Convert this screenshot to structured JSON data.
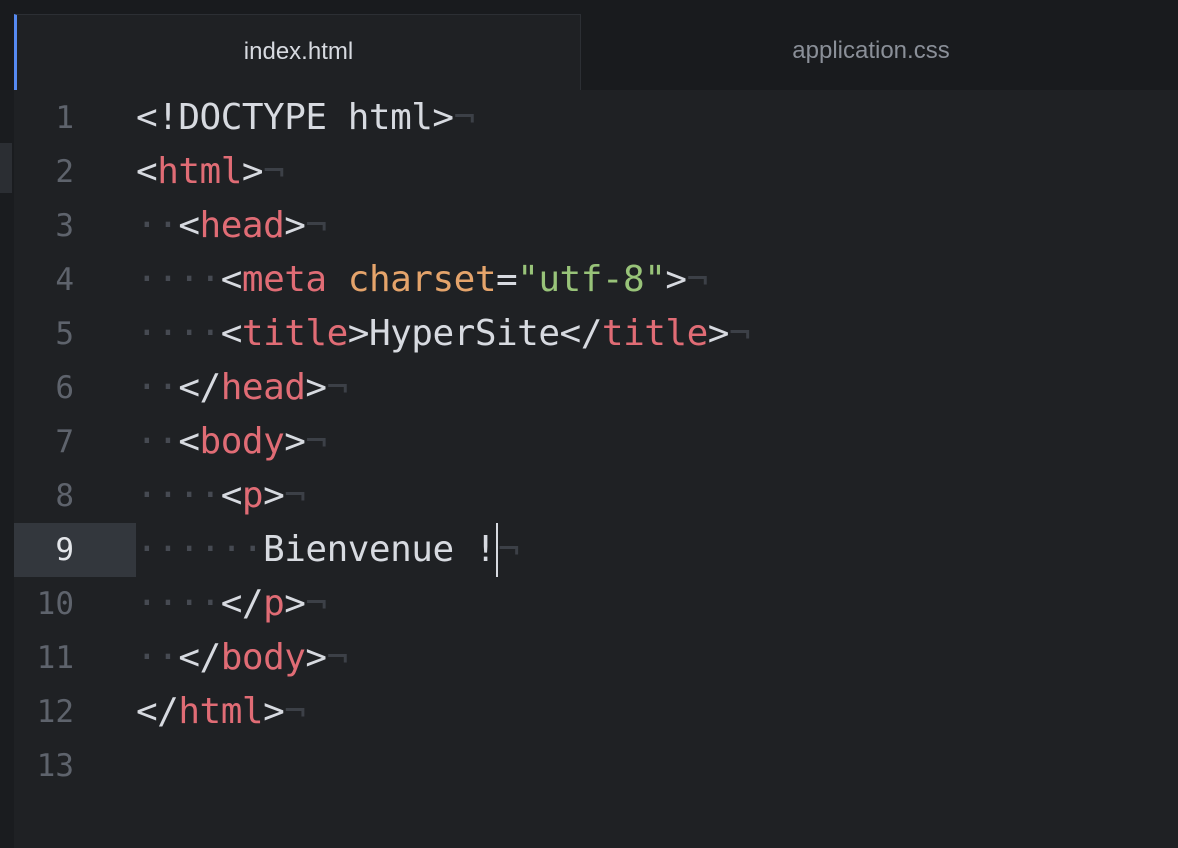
{
  "tabs": [
    {
      "label": "index.html",
      "active": true
    },
    {
      "label": "application.css",
      "active": false
    }
  ],
  "editor": {
    "current_line": 9,
    "lines": [
      {
        "num": "1",
        "tokens": [
          {
            "t": "<!DOCTYPE html>",
            "c": "p"
          },
          {
            "t": "¬",
            "c": "eol"
          }
        ]
      },
      {
        "num": "2",
        "tokens": [
          {
            "t": "<",
            "c": "p"
          },
          {
            "t": "html",
            "c": "tag"
          },
          {
            "t": ">",
            "c": "p"
          },
          {
            "t": "¬",
            "c": "eol"
          }
        ]
      },
      {
        "num": "3",
        "tokens": [
          {
            "t": "··",
            "c": "ind"
          },
          {
            "t": "<",
            "c": "p"
          },
          {
            "t": "head",
            "c": "tag"
          },
          {
            "t": ">",
            "c": "p"
          },
          {
            "t": "¬",
            "c": "eol"
          }
        ]
      },
      {
        "num": "4",
        "tokens": [
          {
            "t": "····",
            "c": "ind"
          },
          {
            "t": "<",
            "c": "p"
          },
          {
            "t": "meta",
            "c": "tag"
          },
          {
            "t": " ",
            "c": "p"
          },
          {
            "t": "charset",
            "c": "attr"
          },
          {
            "t": "=",
            "c": "p"
          },
          {
            "t": "\"utf-8\"",
            "c": "str"
          },
          {
            "t": ">",
            "c": "p"
          },
          {
            "t": "¬",
            "c": "eol"
          }
        ]
      },
      {
        "num": "5",
        "tokens": [
          {
            "t": "····",
            "c": "ind"
          },
          {
            "t": "<",
            "c": "p"
          },
          {
            "t": "title",
            "c": "tag"
          },
          {
            "t": ">",
            "c": "p"
          },
          {
            "t": "HyperSite",
            "c": "txt"
          },
          {
            "t": "</",
            "c": "p"
          },
          {
            "t": "title",
            "c": "tag"
          },
          {
            "t": ">",
            "c": "p"
          },
          {
            "t": "¬",
            "c": "eol"
          }
        ]
      },
      {
        "num": "6",
        "tokens": [
          {
            "t": "··",
            "c": "ind"
          },
          {
            "t": "</",
            "c": "p"
          },
          {
            "t": "head",
            "c": "tag"
          },
          {
            "t": ">",
            "c": "p"
          },
          {
            "t": "¬",
            "c": "eol"
          }
        ]
      },
      {
        "num": "7",
        "tokens": [
          {
            "t": "··",
            "c": "ind"
          },
          {
            "t": "<",
            "c": "p"
          },
          {
            "t": "body",
            "c": "tag"
          },
          {
            "t": ">",
            "c": "p"
          },
          {
            "t": "¬",
            "c": "eol"
          }
        ]
      },
      {
        "num": "8",
        "tokens": [
          {
            "t": "····",
            "c": "ind"
          },
          {
            "t": "<",
            "c": "p"
          },
          {
            "t": "p",
            "c": "tag"
          },
          {
            "t": ">",
            "c": "p"
          },
          {
            "t": "¬",
            "c": "eol"
          }
        ]
      },
      {
        "num": "9",
        "tokens": [
          {
            "t": "······",
            "c": "ind"
          },
          {
            "t": "Bienvenue !",
            "c": "txt"
          },
          {
            "t": "",
            "c": "cursor"
          },
          {
            "t": "¬",
            "c": "eol"
          }
        ]
      },
      {
        "num": "10",
        "tokens": [
          {
            "t": "····",
            "c": "ind"
          },
          {
            "t": "</",
            "c": "p"
          },
          {
            "t": "p",
            "c": "tag"
          },
          {
            "t": ">",
            "c": "p"
          },
          {
            "t": "¬",
            "c": "eol"
          }
        ]
      },
      {
        "num": "11",
        "tokens": [
          {
            "t": "··",
            "c": "ind"
          },
          {
            "t": "</",
            "c": "p"
          },
          {
            "t": "body",
            "c": "tag"
          },
          {
            "t": ">",
            "c": "p"
          },
          {
            "t": "¬",
            "c": "eol"
          }
        ]
      },
      {
        "num": "12",
        "tokens": [
          {
            "t": "</",
            "c": "p"
          },
          {
            "t": "html",
            "c": "tag"
          },
          {
            "t": ">",
            "c": "p"
          },
          {
            "t": "¬",
            "c": "eol"
          }
        ]
      },
      {
        "num": "13",
        "tokens": []
      }
    ]
  },
  "colors": {
    "background": "#1f2124",
    "tag": "#e06c75",
    "attribute": "#e5a46b",
    "string": "#98c379",
    "text": "#d7dae0",
    "active_tab_indicator": "#568af2"
  }
}
